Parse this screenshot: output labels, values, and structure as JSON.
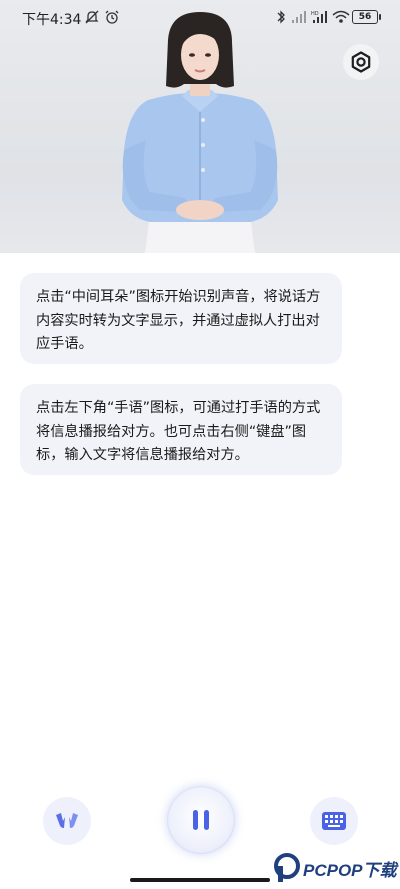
{
  "status_bar": {
    "time": "下午4:34",
    "network_label": "HD",
    "battery": "56"
  },
  "avatar": {
    "description_icon": "sign-language-avatar"
  },
  "settings": {
    "icon": "gear-icon"
  },
  "messages": [
    {
      "text": "点击“中间耳朵”图标开始识别声音，将说话方内容实时转为文字显示，并通过虚拟人打出对应手语。"
    },
    {
      "text": "点击左下角“手语”图标，可通过打手语的方式将信息播报给对方。也可点击右侧“键盘”图标，输入文字将信息播报给对方。"
    }
  ],
  "bottom_bar": {
    "left_icon": "sign-language-hands-icon",
    "center_icon": "pause-icon",
    "right_icon": "keyboard-icon"
  },
  "colors": {
    "accent": "#4a63e6",
    "bubble_bg": "#f1f3f9",
    "stage_bg": "#e4e6ea",
    "shirt": "#a9c6ef"
  },
  "watermark": {
    "text": "PCPOP下载"
  }
}
